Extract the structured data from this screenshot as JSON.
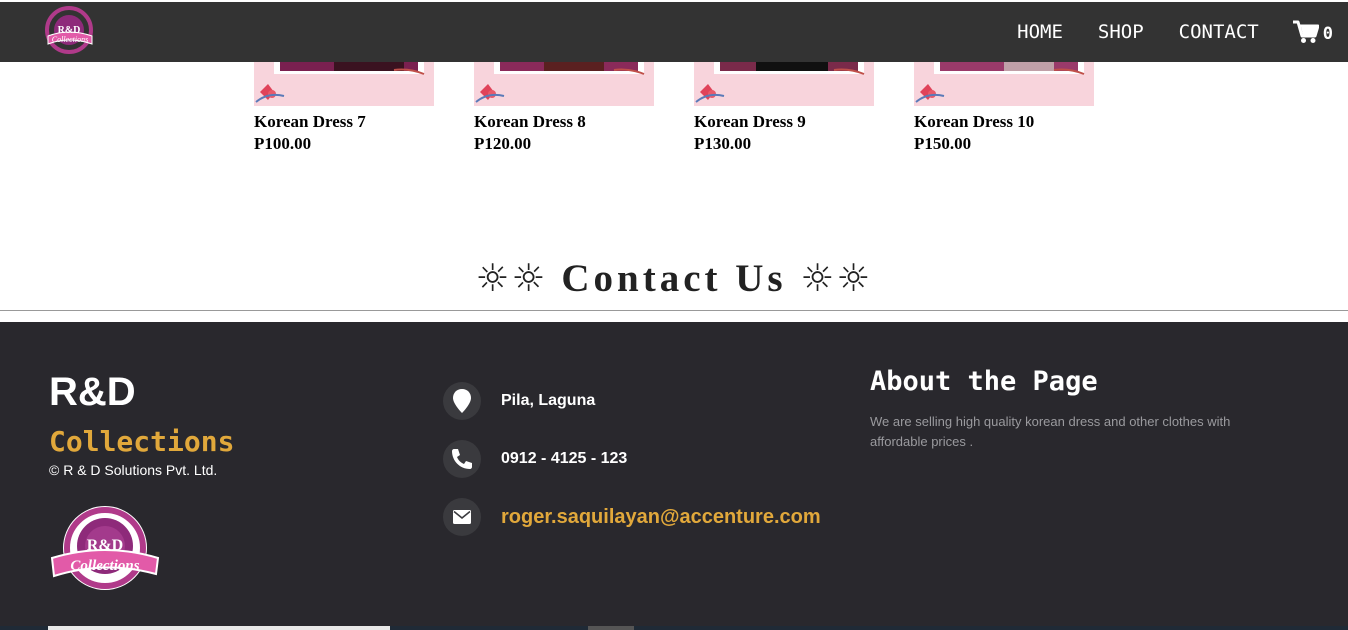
{
  "navbar": {
    "logo_icon": "rd-collections-logo",
    "links": [
      "HOME",
      "SHOP",
      "CONTACT"
    ],
    "cart_icon": "shopping-cart-icon",
    "cart_count": "0"
  },
  "products": [
    {
      "name": "Korean Dress 7",
      "price": "P100.00"
    },
    {
      "name": "Korean Dress 8",
      "price": "P120.00"
    },
    {
      "name": "Korean Dress 9",
      "price": "P130.00"
    },
    {
      "name": "Korean Dress 10",
      "price": "P150.00"
    }
  ],
  "contact_heading": {
    "suns_left": "☼☼",
    "title": "Contact Us",
    "suns_right": "☼☼"
  },
  "footer": {
    "brand_name": "R&D",
    "brand_sub": "Collections",
    "copyright": "© R & D Solutions Pvt. Ltd.",
    "logo_icon": "rd-collections-logo",
    "info": {
      "location": "Pila, Laguna",
      "phone": "0912 - 4125 - 123",
      "email": "roger.saquilayan@accenture.com"
    },
    "about_title": "About the Page",
    "about_text": "We are selling high quality korean dress and other clothes with affordable prices ."
  },
  "colors": {
    "navbar_bg": "#333333",
    "footer_bg": "#29282d",
    "accent_gold": "#e1a83b",
    "product_bg": "#f8d4dc"
  }
}
